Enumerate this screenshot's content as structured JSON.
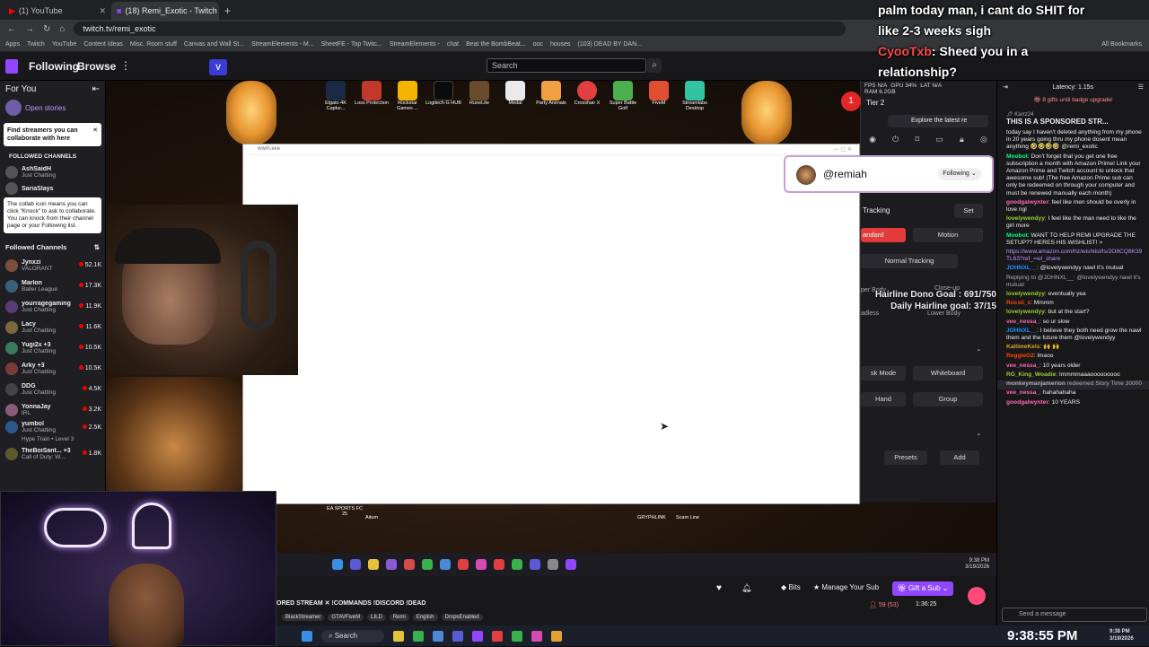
{
  "browser": {
    "tabs": [
      "(1) YouTube",
      "(18) Remi_Exotic - Twitch"
    ],
    "url": "twitch.tv/remi_exotic",
    "bookmarks": [
      "Apps",
      "Twitch",
      "YouTube",
      "Content Ideas",
      "Misc. Room stuff",
      "Canvas and Wall St...",
      "StreamElements - M...",
      "SheetFE - Top Twitc...",
      "StreamElements -",
      "chat",
      "Beat the BombBeat...",
      "ooc",
      "houses",
      "(103) DEAD BY DAN...",
      "All Bookmarks"
    ]
  },
  "twitch": {
    "following": "Following",
    "browse": "Browse",
    "search_placeholder": "Search"
  },
  "sidebar": {
    "for_you": "For You",
    "open_stories": "Open stories",
    "find_streamers": "Find streamers you can collaborate with here",
    "followed_channels_hdr": "FOLLOWED CHANNELS",
    "stories": [
      {
        "name": "AshSaidH",
        "sub": "Just Chatting"
      },
      {
        "name": "SariaSlays",
        "sub": ""
      }
    ],
    "collab_note": "The collab icon means you can click \"Knock\" to ask to collaborate. You can knock from their channel page or your Following list.",
    "followed_channels": "Followed Channels",
    "channels": [
      {
        "name": "Jynxzi",
        "game": "VALORANT",
        "viewers": "52.1K"
      },
      {
        "name": "Marlon",
        "game": "Baller League",
        "viewers": "17.3K"
      },
      {
        "name": "yourragegaming",
        "game": "Just Chatting",
        "viewers": "11.9K"
      },
      {
        "name": "Lacy",
        "game": "Just Chatting",
        "viewers": "11.6K"
      },
      {
        "name": "Yugi2x +3",
        "game": "Just Chatting",
        "viewers": "10.5K"
      },
      {
        "name": "Arky +3",
        "game": "Just Chatting",
        "viewers": "10.5K"
      },
      {
        "name": "DDG",
        "game": "Just Chatting",
        "viewers": "4.5K"
      },
      {
        "name": "YonnaJay",
        "game": "IRL",
        "viewers": "3.2K"
      },
      {
        "name": "yumbol",
        "game": "Just Chatting",
        "viewers": "2.5K"
      },
      {
        "name": "",
        "game": "Hype Train • Level 3",
        "viewers": ""
      },
      {
        "name": "TheBoiSant... +3",
        "game": "Call of Duty: W...",
        "viewers": "1.8K"
      }
    ]
  },
  "stream": {
    "desktop_icons": [
      {
        "label": "Elgato 4K Captur...",
        "color": "#1a2a44"
      },
      {
        "label": "Loss Protection",
        "color": "#c0392b"
      },
      {
        "label": "Rockstar Games ...",
        "color": "#f5b400"
      },
      {
        "label": "Logitech G HUB",
        "color": "#0b0b0b"
      },
      {
        "label": "RuneLite",
        "color": "#6a4c2c"
      },
      {
        "label": "Medal",
        "color": "#eaeaea"
      },
      {
        "label": "Party Animals",
        "color": "#f0a040"
      },
      {
        "label": "Crosshair X",
        "color": "#e04040"
      },
      {
        "label": "Super Battle Golf",
        "color": "#4caf50"
      },
      {
        "label": "FiveM",
        "color": "#e05030"
      },
      {
        "label": "Streamlabs Desktop",
        "color": "#31c3a2"
      }
    ],
    "bottom_icons": [
      "EA SPORTS FC 25",
      "Aitum",
      "GRYPHLINK",
      "Scam Line"
    ],
    "window_title": "wwm.exe",
    "follow_user": "@remiah",
    "follow_btn": "Following",
    "goal1": "Hairline Dono Goal : 691/750",
    "goal2": "Daily Hairline goal: 37/15",
    "overlay_chat": {
      "line1": "palm today man, i cant do SHIT for",
      "line2": "like 2-3 weeks sigh",
      "user": "CyooTxb",
      "line3": ": Sheed you in a",
      "line4": "relationship?"
    },
    "obs": {
      "fps": "FPS N/A",
      "gpu": "GPU 34%",
      "ram": "RAM 6.2GB",
      "lat": "LAT N/A",
      "tier": "Tier 2",
      "explore": "Explore the latest re",
      "tracking": "Tracking",
      "set": "Set",
      "standard": "andard",
      "motion": "Motion",
      "normal": "Normal Tracking",
      "upper": "per Body",
      "close": "Close-up",
      "headless": "adless",
      "lower": "Lower Body",
      "desk": "sk Mode",
      "whiteboard": "Whiteboard",
      "hand": "Hand",
      "group": "Group",
      "presets": "Presets",
      "add": "Add"
    },
    "below": {
      "title": "ORED STREAM ✕ !COMMANDS !DISCORD !DEAD",
      "tags": [
        "BlackStreamer",
        "GTAVFiveM",
        "LILD",
        "Remi",
        "English",
        "DropsEnabled"
      ],
      "bits": "Bits",
      "manage_sub": "Manage Your Sub",
      "gift_sub": "Gift a Sub",
      "viewers": "59 (53)",
      "uptime": "1:36:25"
    },
    "inner_time": "9:38 PM",
    "inner_date": "3/19/2026",
    "search_label": "Search"
  },
  "chat": {
    "latency": "Latency: 1.15s",
    "gifts": "8 gifts until badge upgrade!",
    "pinned_by": "Karrz24",
    "pinned": "THIS IS A SPONSORED STR...",
    "messages": [
      {
        "user": "",
        "color": "#efeff1",
        "text": "today say I haven't deleted anything from my phone in 20 years going thru my phone dosent mean anything 🤣🤣🤣🤣 @remi_exotic"
      },
      {
        "user": "Moobot",
        "color": "#00ff7f",
        "text": "Don't forget that you get one free subscription a month with Amazon Prime! Link your Amazon Prime and Twitch account to unlock that awesome sub! (The free Amazon Prime sub can only be redeemed on through your computer and must be renewed manually each month)"
      },
      {
        "user": "goodgalwynter",
        "color": "#ff69b4",
        "text": "feel like men should be overly in love ngl"
      },
      {
        "user": "lovelywendyy",
        "color": "#9acd32",
        "text": "I feel like the man need to like the girl more"
      },
      {
        "user": "Moobot",
        "color": "#00ff7f",
        "text": "WANT TO HELP REMI UPGRADE THE SETUP?? HERES HIS WISHLIST! >"
      },
      {
        "user": "",
        "color": "#bf94ff",
        "text": "https://www.amazon.com/hz/wishlist/ls/2O8CQ8K39TL63?ref_=wl_share"
      },
      {
        "user": "JOHNXL__",
        "color": "#1e90ff",
        "text": "@lovelywendyy nawl it's mutual"
      },
      {
        "user": "",
        "color": "#adadb8",
        "text": "Replying to @JOHNXL__: @lovelywendyy nawl it's mutual"
      },
      {
        "user": "lovelywendyy",
        "color": "#9acd32",
        "text": "eventually yea"
      },
      {
        "user": "Rocsii_x",
        "color": "#ff4500",
        "text": "Mmmm"
      },
      {
        "user": "lovelywendyy",
        "color": "#9acd32",
        "text": "but at the start?"
      },
      {
        "user": "vee_nessa_",
        "color": "#ff69b4",
        "text": "so ur slow"
      },
      {
        "user": "JOHNXL__",
        "color": "#1e90ff",
        "text": "I believe they both need grow the nawl them and the future them @lovelywendyy"
      },
      {
        "user": "KallimeKels",
        "color": "#daa520",
        "text": "🙌 🙌"
      },
      {
        "user": "ReggieG2",
        "color": "#ff4500",
        "text": "lmaoo"
      },
      {
        "user": "vee_nessa_",
        "color": "#ff69b4",
        "text": "10 years older"
      },
      {
        "user": "RG_King_Woadie",
        "color": "#9acd32",
        "text": "Immmmaaaooooooooo"
      },
      {
        "user": "monkeymanjamerion",
        "color": "#adadb8",
        "text": "redeemed Story Time 30000"
      },
      {
        "user": "vee_nessa_",
        "color": "#ff69b4",
        "text": "hahahahaha"
      },
      {
        "user": "goodgalwynter",
        "color": "#ff69b4",
        "text": "10 YEARS"
      }
    ],
    "send_placeholder": "Send a message"
  },
  "taskbar": {
    "search": "Search",
    "time": "9:38:55 PM",
    "time_small": "9:38 PM",
    "date_small": "3/19/2026"
  }
}
